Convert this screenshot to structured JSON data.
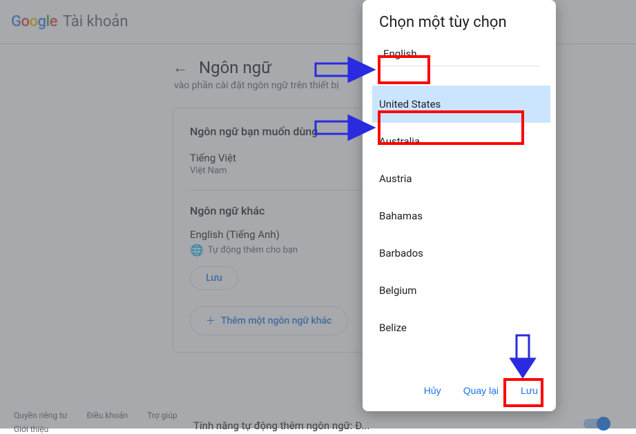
{
  "header": {
    "brand": "Google",
    "account_label": "Tài khoản"
  },
  "page": {
    "title": "Ngôn ngữ",
    "subtitle": "vào phần cài đặt ngôn ngữ trên thiết bị"
  },
  "preferred": {
    "section_title": "Ngôn ngữ bạn muốn dùng",
    "language": "Tiếng Việt",
    "region": "Việt Nam"
  },
  "other": {
    "section_title": "Ngôn ngữ khác",
    "language": "English (Tiếng Anh)",
    "auto_added": "Tự động thêm cho bạn",
    "save_label": "Lưu"
  },
  "add_lang_label": "Thêm một ngôn ngữ khác",
  "footer": {
    "privacy": "Quyền riêng tư",
    "terms": "Điều khoản",
    "help": "Trợ giúp",
    "about": "Giới thiệu"
  },
  "auto_detect_label": "Tính năng tự động thêm ngôn ngữ: Đ...",
  "modal": {
    "title": "Chọn một tùy chọn",
    "language_choice": "English",
    "countries": [
      "United States",
      "Australia",
      "Austria",
      "Bahamas",
      "Barbados",
      "Belgium",
      "Belize"
    ],
    "selected_index": 0,
    "cancel": "Hủy",
    "back": "Quay lại",
    "save": "Lưu"
  }
}
